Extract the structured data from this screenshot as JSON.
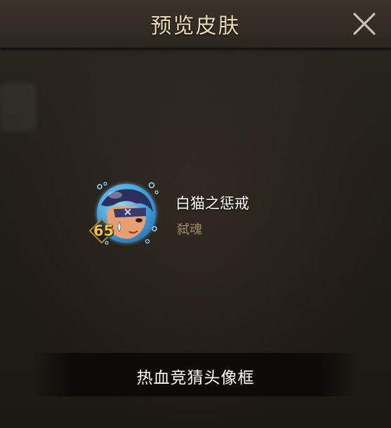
{
  "dialog": {
    "title": "预览皮肤",
    "close_icon": "close-x-icon"
  },
  "skin": {
    "name": "白猫之惩戒",
    "hero": "弑魂",
    "level": "65",
    "avatar_icon": "hero-avatar-portrait-icon"
  },
  "action": {
    "label": "热血竞猜头像框"
  },
  "colors": {
    "title": "#e9d9b4",
    "level": "#f2c24a",
    "hero": "#a08868"
  }
}
